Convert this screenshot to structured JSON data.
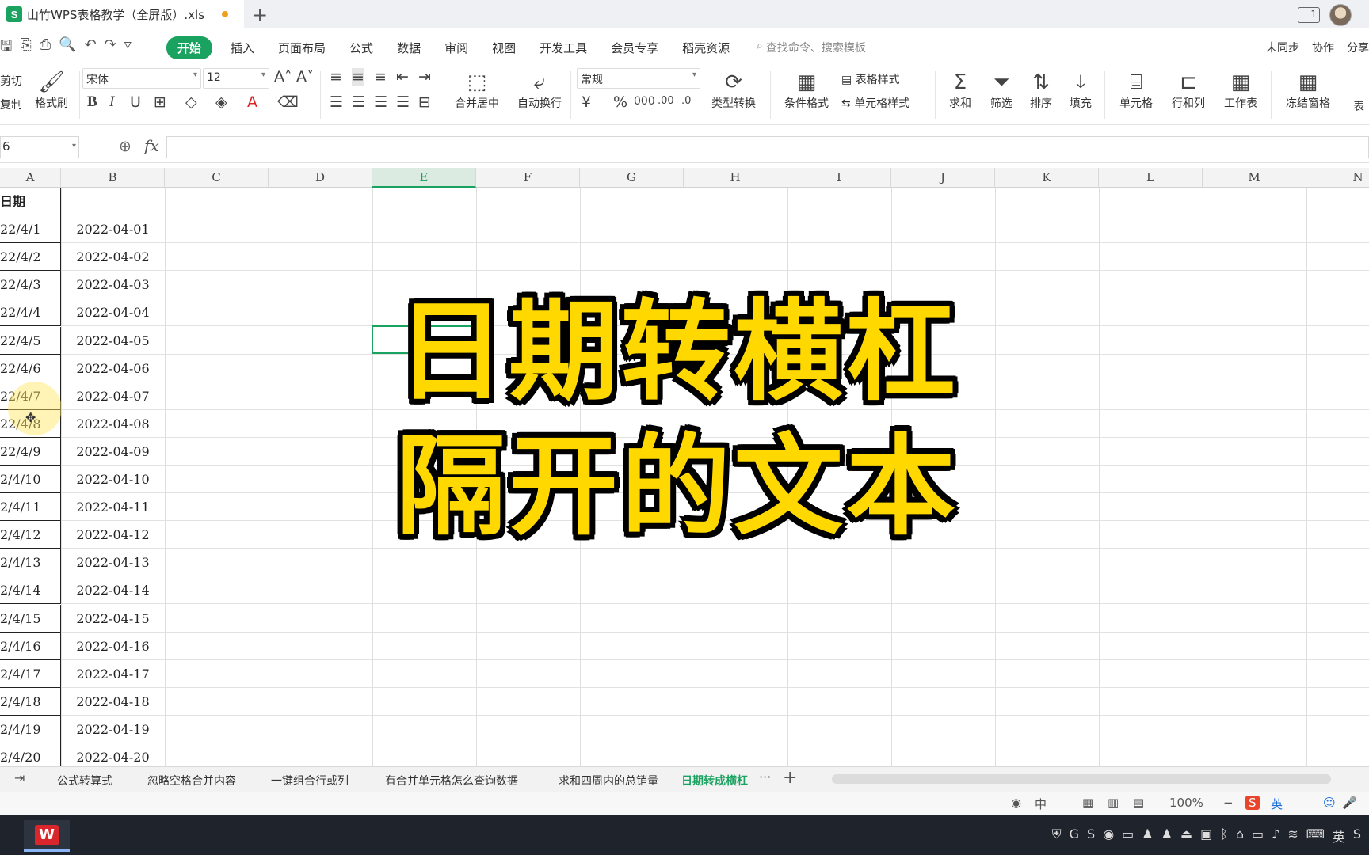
{
  "window": {
    "doc_title": "山竹WPS表格教学（全屏版）.xls",
    "new_tab_symbol": "+",
    "win_icon_label": "1"
  },
  "menu": {
    "items": [
      "开始",
      "插入",
      "页面布局",
      "公式",
      "数据",
      "审阅",
      "视图",
      "开发工具",
      "会员专享",
      "稻壳资源"
    ],
    "search_placeholder": "查找命令、搜索模板",
    "right": [
      "未同步",
      "协作",
      "分享"
    ]
  },
  "ribbon": {
    "clipboard": {
      "cut": "剪切",
      "copy": "复制",
      "format_painter": "格式刷"
    },
    "font_name": "宋体",
    "font_size": "12",
    "merge_center": "合并居中",
    "auto_wrap": "自动换行",
    "number_format": "常规",
    "type_convert": "类型转换",
    "conditional_format": "条件格式",
    "table_style": "表格样式",
    "cell_style": "单元格样式",
    "sum": "求和",
    "filter": "筛选",
    "sort": "排序",
    "fill": "填充",
    "cell": "单元格",
    "row_col": "行和列",
    "worksheet": "工作表",
    "freeze": "冻结窗格",
    "table_tool": "表"
  },
  "formula_bar": {
    "name_box": "6",
    "fx_label": "fx",
    "formula": ""
  },
  "grid": {
    "columns": [
      "A",
      "B",
      "C",
      "D",
      "E",
      "F",
      "G",
      "H",
      "I",
      "J",
      "K",
      "L",
      "M",
      "N"
    ],
    "selected_column": "E",
    "header_a": "日期",
    "rows": [
      {
        "a": "22/4/1",
        "b": "2022-04-01"
      },
      {
        "a": "22/4/2",
        "b": "2022-04-02"
      },
      {
        "a": "22/4/3",
        "b": "2022-04-03"
      },
      {
        "a": "22/4/4",
        "b": "2022-04-04"
      },
      {
        "a": "22/4/5",
        "b": "2022-04-05"
      },
      {
        "a": "22/4/6",
        "b": "2022-04-06"
      },
      {
        "a": "22/4/7",
        "b": "2022-04-07"
      },
      {
        "a": "22/4/8",
        "b": "2022-04-08"
      },
      {
        "a": "22/4/9",
        "b": "2022-04-09"
      },
      {
        "a": "2/4/10",
        "b": "2022-04-10"
      },
      {
        "a": "2/4/11",
        "b": "2022-04-11"
      },
      {
        "a": "2/4/12",
        "b": "2022-04-12"
      },
      {
        "a": "2/4/13",
        "b": "2022-04-13"
      },
      {
        "a": "2/4/14",
        "b": "2022-04-14"
      },
      {
        "a": "2/4/15",
        "b": "2022-04-15"
      },
      {
        "a": "2/4/16",
        "b": "2022-04-16"
      },
      {
        "a": "2/4/17",
        "b": "2022-04-17"
      },
      {
        "a": "2/4/18",
        "b": "2022-04-18"
      },
      {
        "a": "2/4/19",
        "b": "2022-04-19"
      },
      {
        "a": "2/4/20",
        "b": "2022-04-20"
      }
    ]
  },
  "overlay": {
    "line1": "日期转横杠",
    "line2": "隔开的文本"
  },
  "sheets": {
    "tabs": [
      "公式转算式",
      "忽略空格合并内容",
      "一键组合行或列",
      "有合并单元格怎么查询数据",
      "求和四周内的总销量",
      "日期转成横杠"
    ],
    "active_index": 5,
    "more": "···",
    "add": "+"
  },
  "status": {
    "zoom": "100%",
    "input_lang": "中",
    "ime_lang": "英"
  },
  "colors": {
    "accent": "#1aa260",
    "overlay_fill": "#ffd800",
    "overlay_stroke": "#000000"
  }
}
